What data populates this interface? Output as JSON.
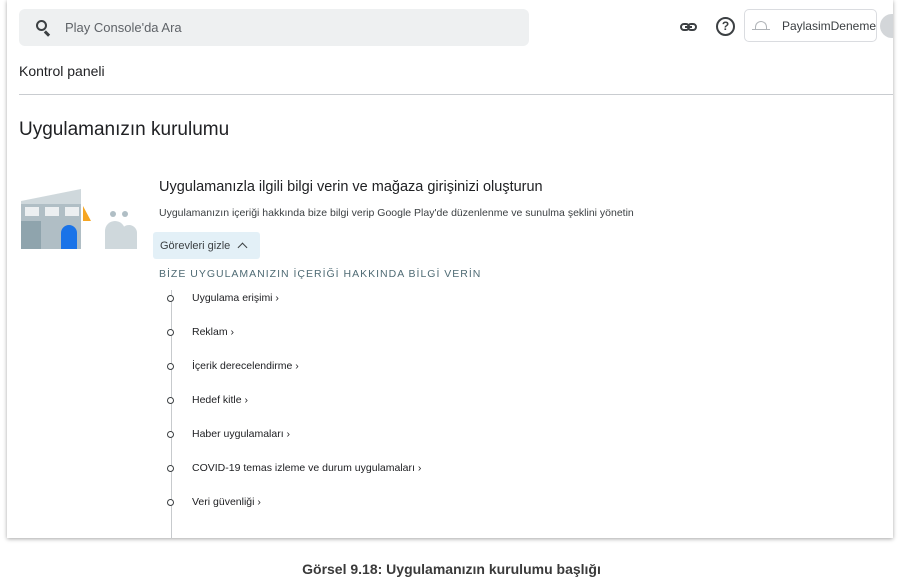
{
  "header": {
    "search_placeholder": "Play Console'da Ara",
    "app_name": "PaylasimDeneme"
  },
  "breadcrumb": "Kontrol paneli",
  "section_title": "Uygulamanızın kurulumu",
  "card": {
    "title": "Uygulamanızla ilgili bilgi verin ve mağaza girişinizi oluşturun",
    "subtitle": "Uygulamanızın içeriği hakkında bize bilgi verip Google Play'de düzenlenme ve sunulma şeklini yönetin",
    "toggle_label": "Görevleri gizle",
    "group_heading": "BİZE UYGULAMANIZIN İÇERİĞİ HAKKINDA BİLGİ VERİN",
    "tasks": [
      {
        "label": "Uygulama erişimi ›"
      },
      {
        "label": "Reklam ›"
      },
      {
        "label": "İçerik derecelendirme ›"
      },
      {
        "label": "Hedef kitle ›"
      },
      {
        "label": "Haber uygulamaları ›"
      },
      {
        "label": "COVID-19 temas izleme ve durum uygulamaları ›"
      },
      {
        "label": "Veri güvenliği ›"
      }
    ]
  },
  "caption": "Görsel 9.18: Uygulamanızın kurulumu başlığı",
  "colors": {
    "accent_toggle_bg": "#e3f0f7",
    "illustration_blue": "#1a73e8",
    "illustration_orange": "#f6a623"
  },
  "icons": [
    "search-icon",
    "link-icon",
    "help-icon",
    "android-icon",
    "chevron-up-icon"
  ]
}
